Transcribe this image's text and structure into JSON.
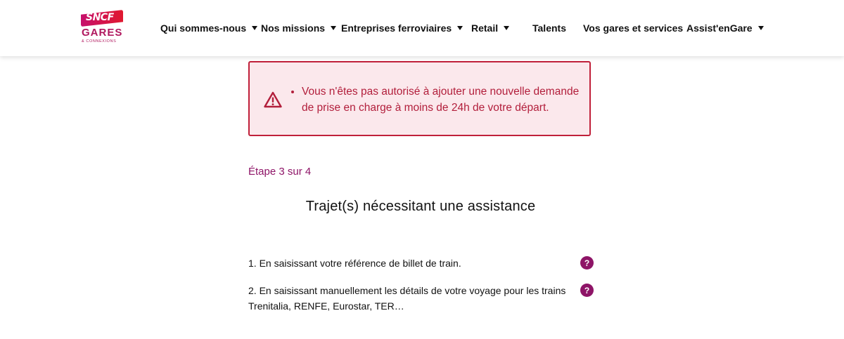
{
  "header": {
    "logo": {
      "brand": "SNCF",
      "name": "GARES",
      "sub": "& CONNEXIONS"
    },
    "nav": [
      {
        "label": "Qui sommes-nous",
        "dropdown": true
      },
      {
        "label": "Nos missions",
        "dropdown": true
      },
      {
        "label": "Entreprises ferroviaires",
        "dropdown": true
      },
      {
        "label": "Retail",
        "dropdown": true
      },
      {
        "label": "Talents",
        "dropdown": false
      },
      {
        "label": "Vos gares et services",
        "dropdown": false
      },
      {
        "label": "Assist'enGare",
        "dropdown": true
      }
    ]
  },
  "alert": {
    "icon": "warning-triangle-icon",
    "message": "Vous n'êtes pas autorisé à ajouter une nouvelle demande de prise en charge à moins de 24h de votre départ.",
    "color": "#c0203a",
    "background": "#fbe8ec"
  },
  "form": {
    "step": "Étape 3 sur 4",
    "title": "Trajet(s) nécessitant une assistance",
    "options": [
      {
        "label": "1. En saisissant votre référence de billet de train.",
        "help": "?"
      },
      {
        "label": "2. En saisissant manuellement les détails de votre voyage pour les trains Trenitalia, RENFE, Eurostar, TER…",
        "help": "?"
      }
    ]
  },
  "colors": {
    "accent": "#8e1467",
    "alert": "#c0203a"
  }
}
